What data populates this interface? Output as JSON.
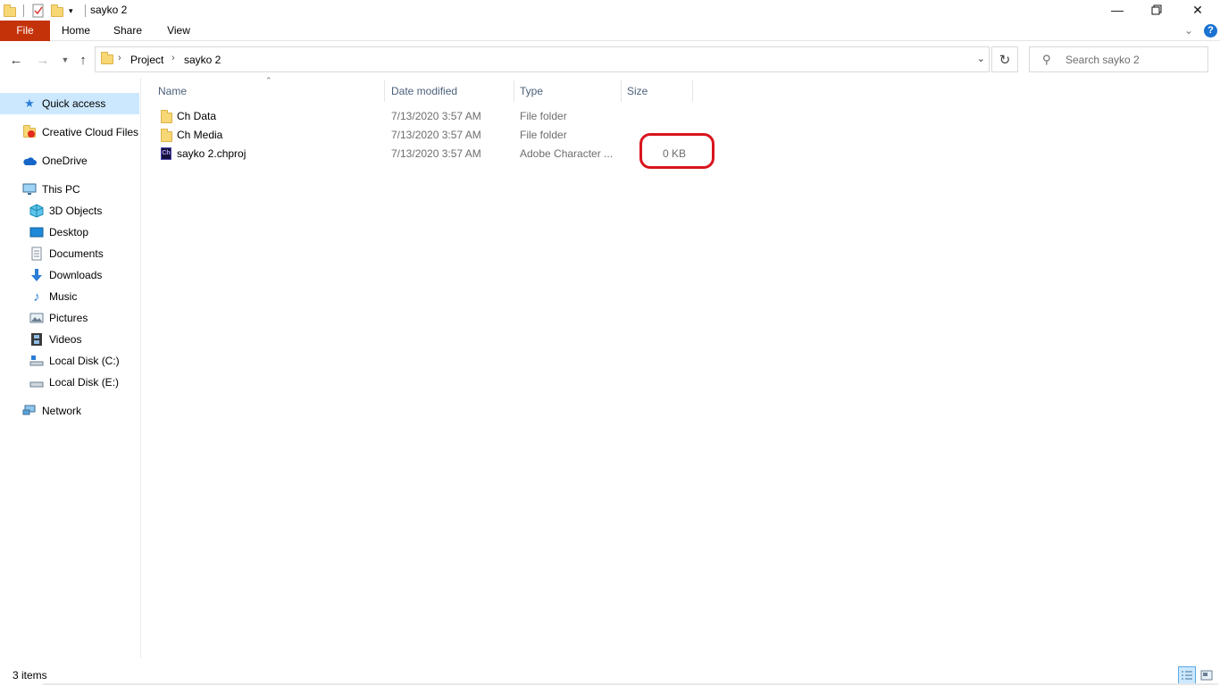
{
  "window": {
    "title": "sayko 2"
  },
  "ribbon": {
    "tabs": [
      "File",
      "Home",
      "Share",
      "View"
    ]
  },
  "address": {
    "crumbs": [
      "Project",
      "sayko 2"
    ],
    "search_placeholder": "Search sayko 2"
  },
  "sidebar": {
    "items": [
      {
        "label": "Quick access",
        "icon": "star-icon"
      },
      {
        "label": "Creative Cloud Files",
        "icon": "creative-cloud-folder-icon"
      },
      {
        "label": "OneDrive",
        "icon": "cloud-icon"
      },
      {
        "label": "This PC",
        "icon": "computer-icon"
      },
      {
        "label": "3D Objects",
        "icon": "cube-icon"
      },
      {
        "label": "Desktop",
        "icon": "desktop-icon"
      },
      {
        "label": "Documents",
        "icon": "document-icon"
      },
      {
        "label": "Downloads",
        "icon": "download-arrow-icon"
      },
      {
        "label": "Music",
        "icon": "music-note-icon"
      },
      {
        "label": "Pictures",
        "icon": "picture-icon"
      },
      {
        "label": "Videos",
        "icon": "film-icon"
      },
      {
        "label": "Local Disk (C:)",
        "icon": "system-drive-icon"
      },
      {
        "label": "Local Disk (E:)",
        "icon": "drive-icon"
      },
      {
        "label": "Network",
        "icon": "network-icon"
      }
    ]
  },
  "columns": {
    "name": "Name",
    "date": "Date modified",
    "type": "Type",
    "size": "Size"
  },
  "files": [
    {
      "name": "Ch Data",
      "date": "7/13/2020 3:57 AM",
      "type": "File folder",
      "size": "",
      "icon": "folder-icon"
    },
    {
      "name": "Ch Media",
      "date": "7/13/2020 3:57 AM",
      "type": "File folder",
      "size": "",
      "icon": "folder-icon"
    },
    {
      "name": "sayko 2.chproj",
      "date": "7/13/2020 3:57 AM",
      "type": "Adobe Character ...",
      "size": "0 KB",
      "icon": "character-animator-icon",
      "icon_text": "Ch"
    }
  ],
  "status": {
    "item_count": "3 items"
  },
  "colors": {
    "file_tab": "#c4320a",
    "selection": "#cce8ff",
    "highlight_ring": "#d9141c"
  }
}
